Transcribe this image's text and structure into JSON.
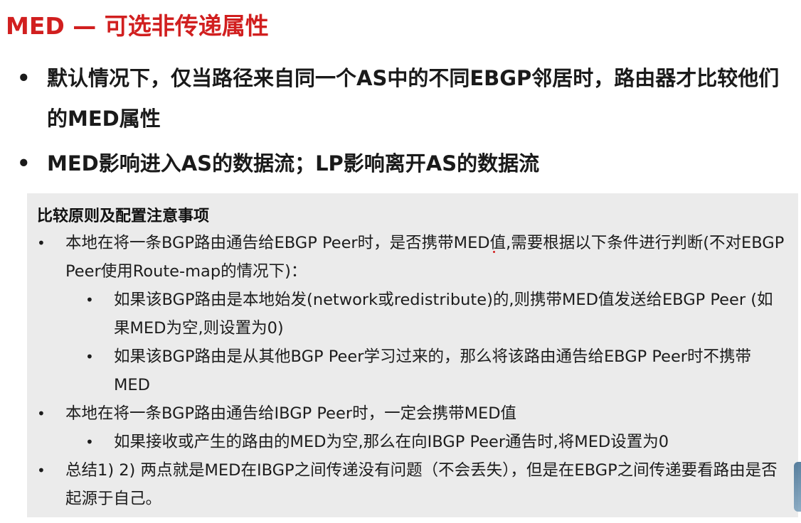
{
  "title": "MED — 可选非传递属性",
  "bullet_symbol": "•",
  "main_bullets": [
    "默认情况下，仅当路径来自同一个AS中的不同EBGP邻居时，路由器才比较他们的MED属性",
    "MED影响进入AS的数据流；LP影响离开AS的数据流"
  ],
  "box": {
    "title": "比较原则及配置注意事项",
    "items": [
      {
        "level": 1,
        "text": "本地在将一条BGP路由通告给EBGP  Peer时，是否携带MED值,需要根据以下条件进行判断(不对EBGP Peer使用Route-map的情况下)："
      },
      {
        "level": 2,
        "text": "如果该BGP路由是本地始发(network或redistribute)的,则携带MED值发送给EBGP Peer (如果MED为空,则设置为0)"
      },
      {
        "level": 2,
        "text": "如果该BGP路由是从其他BGP Peer学习过来的，那么将该路由通告给EBGP Peer时不携带MED"
      },
      {
        "level": 1,
        "text": "本地在将一条BGP路由通告给IBGP  Peer时，一定会携带MED值"
      },
      {
        "level": 2,
        "text": "如果接收或产生的路由的MED为空,那么在向IBGP  Peer通告时,将MED设置为0"
      },
      {
        "level": 1,
        "text": "总结1) 2) 两点就是MED在IBGP之间传递没有问题（不会丢失），但是在EBGP之间传递要看路由是否起源于自己。"
      }
    ]
  }
}
